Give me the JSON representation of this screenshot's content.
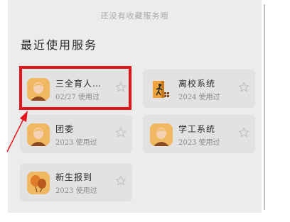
{
  "empty_note": "还没有收藏服务哦",
  "section_title": "最近使用服务",
  "services": [
    {
      "name": "三全育人…",
      "meta": "02/27 使用过",
      "icon": "person-avatar-icon"
    },
    {
      "name": "离校系统",
      "meta": "2024 使用过",
      "icon": "leaving-school-icon"
    },
    {
      "name": "团委",
      "meta": "2023 使用过",
      "icon": "person-avatar-icon"
    },
    {
      "name": "学工系统",
      "meta": "2023 使用过",
      "icon": "person-avatar-icon"
    },
    {
      "name": "新生报到",
      "meta": "2023 使用过",
      "icon": "balloons-icon"
    }
  ],
  "colors": {
    "highlight": "#e3141b",
    "card_bg": "#e2e2e2",
    "panel_bg": "#ececec",
    "icon_bg": "#f0b860"
  }
}
